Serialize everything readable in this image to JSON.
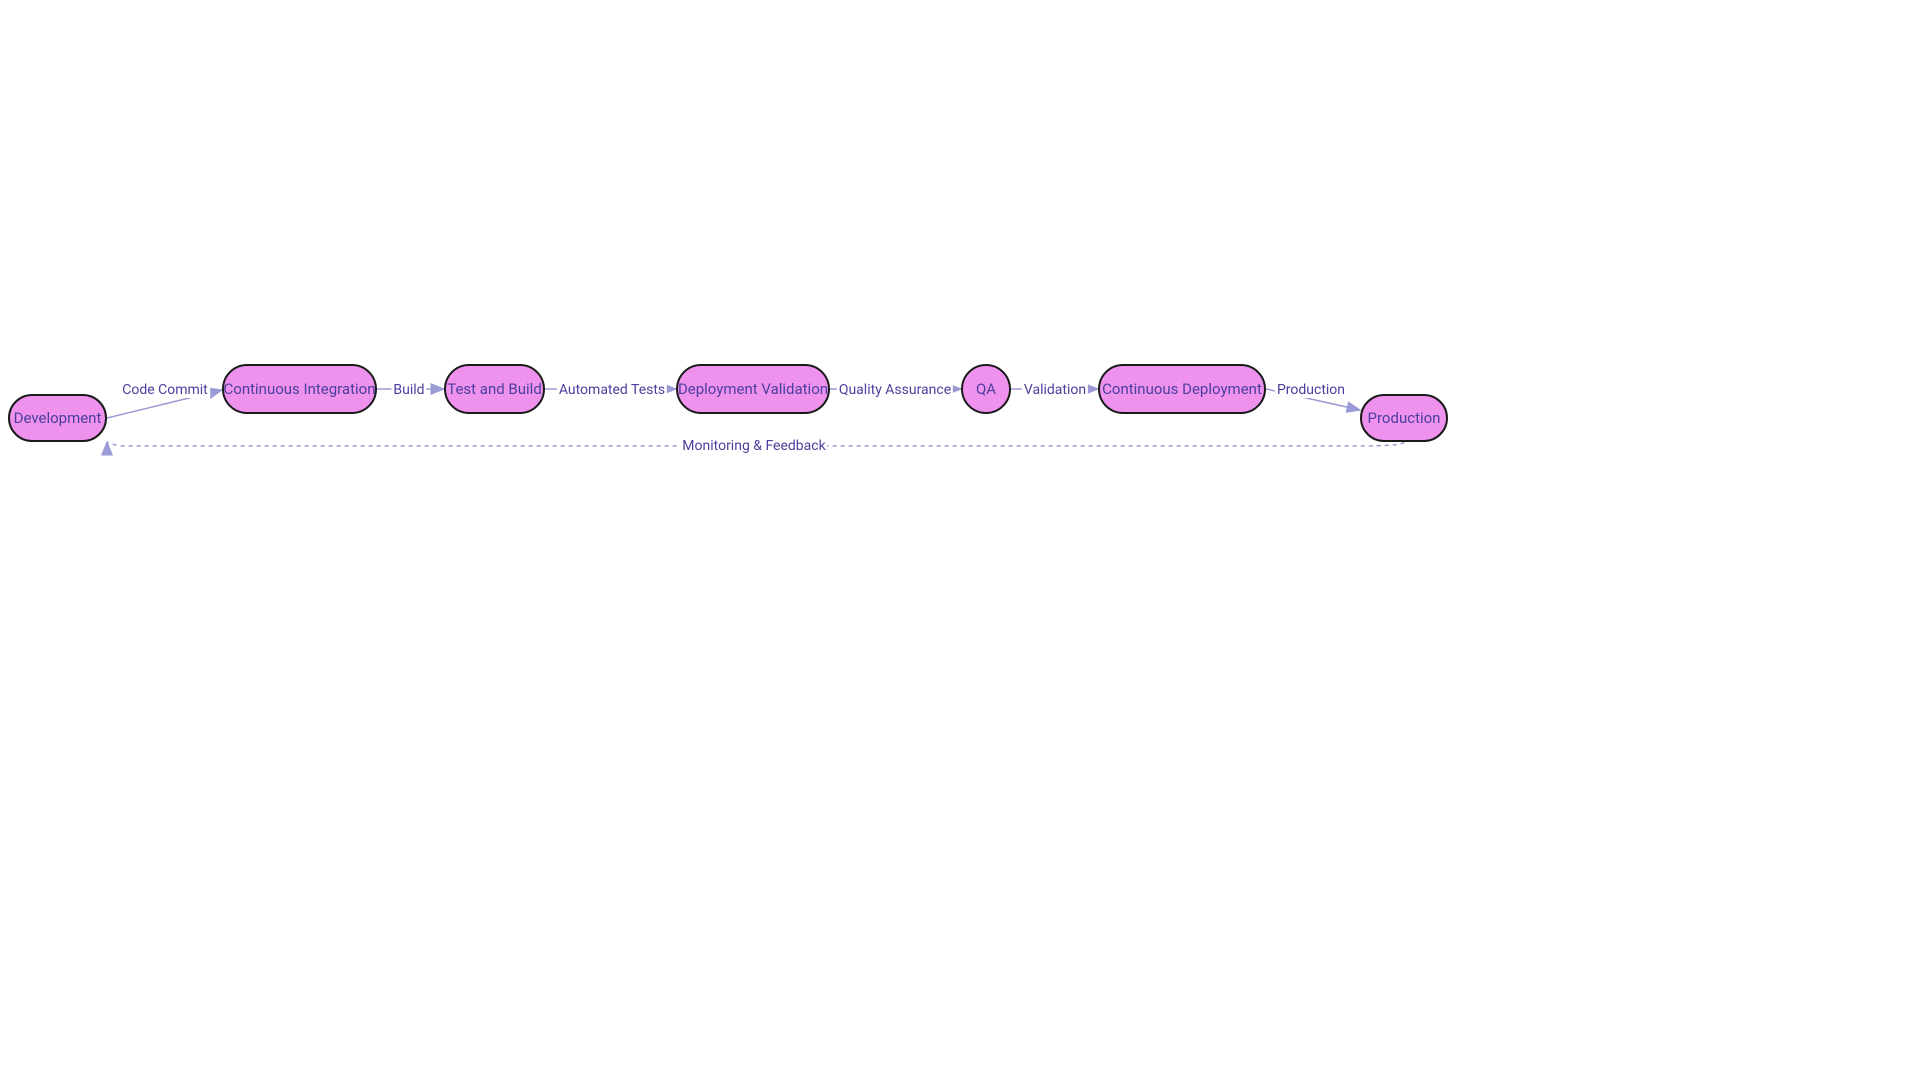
{
  "nodes": {
    "development": {
      "label": "Development"
    },
    "ci": {
      "label": "Continuous Integration"
    },
    "testbuild": {
      "label": "Test and Build"
    },
    "deployval": {
      "label": "Deployment Validation"
    },
    "qa": {
      "label": "QA"
    },
    "cd": {
      "label": "Continuous Deployment"
    },
    "production": {
      "label": "Production"
    }
  },
  "edges": {
    "code_commit": {
      "label": "Code Commit"
    },
    "build": {
      "label": "Build"
    },
    "automated_tests": {
      "label": "Automated Tests"
    },
    "quality_assurance": {
      "label": "Quality Assurance"
    },
    "validation": {
      "label": "Validation"
    },
    "production": {
      "label": "Production"
    },
    "monitoring": {
      "label": "Monitoring & Feedback"
    }
  },
  "colors": {
    "node_fill": "#ee92ee",
    "node_border": "#1a1a1a",
    "text": "#4a3f9e",
    "arrow": "#9a9ad4"
  },
  "diagram_type": "flowchart",
  "flow_description": "CI/CD pipeline flowchart with 7 stages from Development to Production, with a dashed feedback loop back to Development"
}
